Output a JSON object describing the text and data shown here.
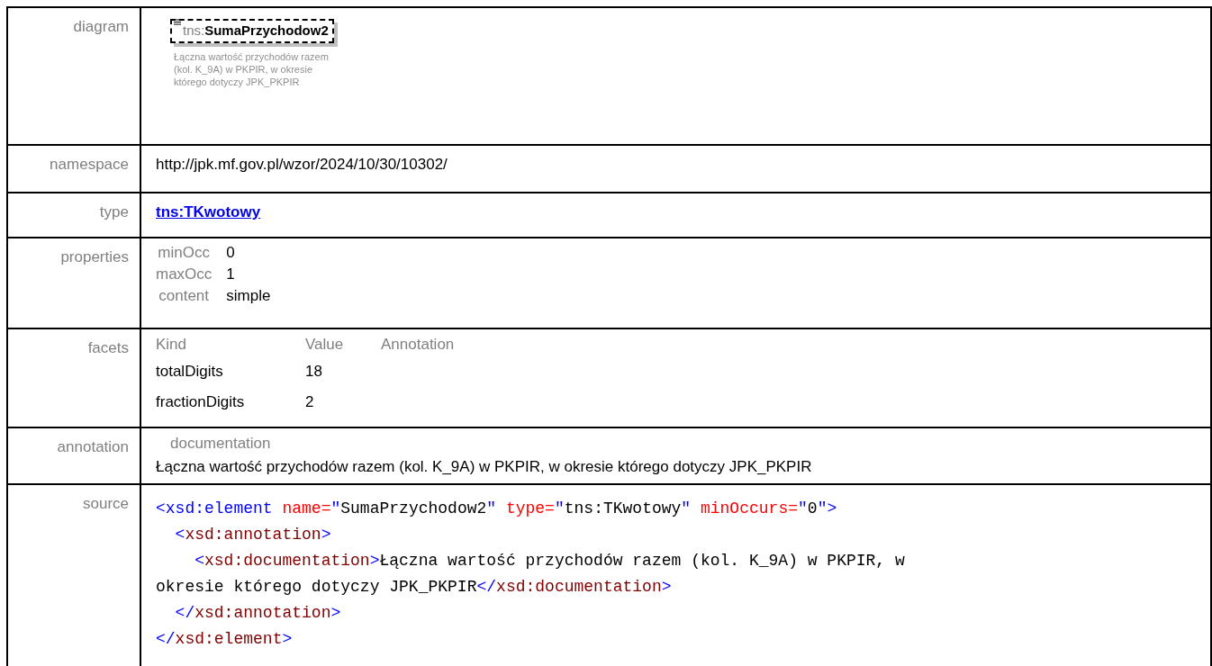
{
  "rows": [
    {
      "label": "diagram",
      "kind": "diagram",
      "prefix": "tns:",
      "name": "SumaPrzychodow2",
      "note": "Łączna wartość przychodów razem (kol. K_9A) w PKPIR, w okresie którego dotyczy JPK_PKPIR"
    },
    {
      "label": "namespace",
      "kind": "text",
      "value": "http://jpk.mf.gov.pl/wzor/2024/10/30/10302/"
    },
    {
      "label": "type",
      "kind": "link",
      "value": "tns:TKwotowy"
    },
    {
      "label": "properties",
      "kind": "properties",
      "items": [
        {
          "key": "minOcc",
          "value": "0"
        },
        {
          "key": "maxOcc",
          "value": "1"
        },
        {
          "key": "content",
          "value": "simple"
        }
      ]
    },
    {
      "label": "facets",
      "kind": "facets",
      "columns": [
        "Kind",
        "Value",
        "Annotation"
      ],
      "items": [
        {
          "kind": "totalDigits",
          "value": "18"
        },
        {
          "kind": "fractionDigits",
          "value": "2"
        }
      ]
    },
    {
      "label": "annotation",
      "kind": "annotation",
      "heading": "documentation",
      "value": "Łączna wartość przychodów razem (kol. K_9A) w PKPIR, w okresie którego dotyczy JPK_PKPIR"
    },
    {
      "label": "source",
      "kind": "source",
      "lines": [
        [
          {
            "kind": "bracket",
            "text": "<xsd:element "
          },
          {
            "kind": "attr",
            "text": "name="
          },
          {
            "kind": "bracket",
            "text": "\""
          },
          {
            "kind": "text",
            "text": "SumaPrzychodow2"
          },
          {
            "kind": "bracket",
            "text": "\" "
          },
          {
            "kind": "attr",
            "text": "type="
          },
          {
            "kind": "bracket",
            "text": "\""
          },
          {
            "kind": "text",
            "text": "tns:TKwotowy"
          },
          {
            "kind": "bracket",
            "text": "\" "
          },
          {
            "kind": "attr",
            "text": "minOccurs="
          },
          {
            "kind": "bracket",
            "text": "\""
          },
          {
            "kind": "text",
            "text": "0"
          },
          {
            "kind": "bracket",
            "text": "\">"
          }
        ],
        [
          {
            "kind": "bracket",
            "text": "  <"
          },
          {
            "kind": "tag",
            "text": "xsd:annotation"
          },
          {
            "kind": "bracket",
            "text": ">"
          }
        ],
        [
          {
            "kind": "bracket",
            "text": "    <"
          },
          {
            "kind": "tag",
            "text": "xsd:documentation"
          },
          {
            "kind": "bracket",
            "text": ">"
          },
          {
            "kind": "text",
            "text": "Łączna wartość przychodów razem (kol. K_9A) w PKPIR, w"
          }
        ],
        [
          {
            "kind": "text",
            "text": "okresie którego dotyczy JPK_PKPIR"
          },
          {
            "kind": "bracket",
            "text": "</"
          },
          {
            "kind": "tag",
            "text": "xsd:documentation"
          },
          {
            "kind": "bracket",
            "text": ">"
          }
        ],
        [
          {
            "kind": "bracket",
            "text": "  </"
          },
          {
            "kind": "tag",
            "text": "xsd:annotation"
          },
          {
            "kind": "bracket",
            "text": ">"
          }
        ],
        [
          {
            "kind": "bracket",
            "text": "</"
          },
          {
            "kind": "tag",
            "text": "xsd:element"
          },
          {
            "kind": "bracket",
            "text": ">"
          }
        ]
      ]
    }
  ]
}
